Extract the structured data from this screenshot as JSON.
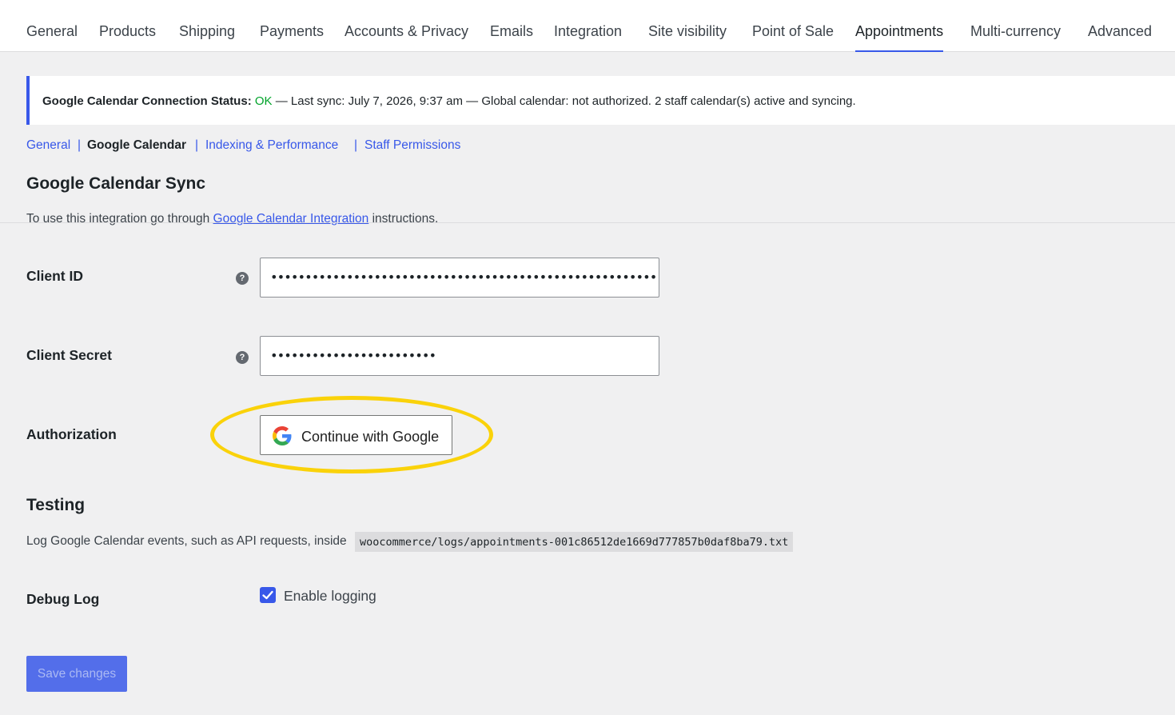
{
  "tabs": [
    {
      "label": "General"
    },
    {
      "label": "Products"
    },
    {
      "label": "Shipping"
    },
    {
      "label": "Payments"
    },
    {
      "label": "Accounts & Privacy"
    },
    {
      "label": "Emails"
    },
    {
      "label": "Integration"
    },
    {
      "label": "Site visibility"
    },
    {
      "label": "Point of Sale"
    },
    {
      "label": "Appointments",
      "active": true
    },
    {
      "label": "Multi-currency"
    },
    {
      "label": "Advanced"
    }
  ],
  "notice": {
    "prefix": "Google Calendar Connection Status:",
    "status": "OK",
    "detail": "— Last sync: July 7, 2026, 9:37 am — Global calendar: not authorized. 2 staff calendar(s) active and syncing.",
    "status_color": "#00a32a",
    "accent_color": "#3858e9"
  },
  "subnav": {
    "items": [
      "General",
      "Google Calendar",
      "Indexing & Performance",
      "Staff Permissions"
    ],
    "current": "Google Calendar",
    "separator": "|"
  },
  "sync_section": {
    "title": "Google Calendar Sync",
    "desc_before": "To use this integration go through",
    "desc_link": "Google Calendar Integration",
    "desc_after": "instructions."
  },
  "fields": {
    "client_id": {
      "label": "Client ID",
      "value": "••••••••••••••••••••••••••••••••••••••••••••••••••••••••••••••••••",
      "help_icon": "question-mark-icon"
    },
    "client_secret": {
      "label": "Client Secret",
      "value": "••••••••••••••••••••••••",
      "help_icon": "question-mark-icon"
    },
    "authorization": {
      "label": "Authorization",
      "button": "Continue with Google",
      "icon": "google-icon"
    }
  },
  "testing": {
    "title": "Testing",
    "desc": "Log Google Calendar events, such as API requests, inside",
    "path": "woocommerce/logs/appointments-001c86512de1669d777857b0daf8ba79.txt"
  },
  "debug": {
    "label": "Debug Log",
    "checkbox_label": "Enable logging",
    "checked": true
  },
  "save_label": "Save changes",
  "highlight_color": "#fad20a"
}
